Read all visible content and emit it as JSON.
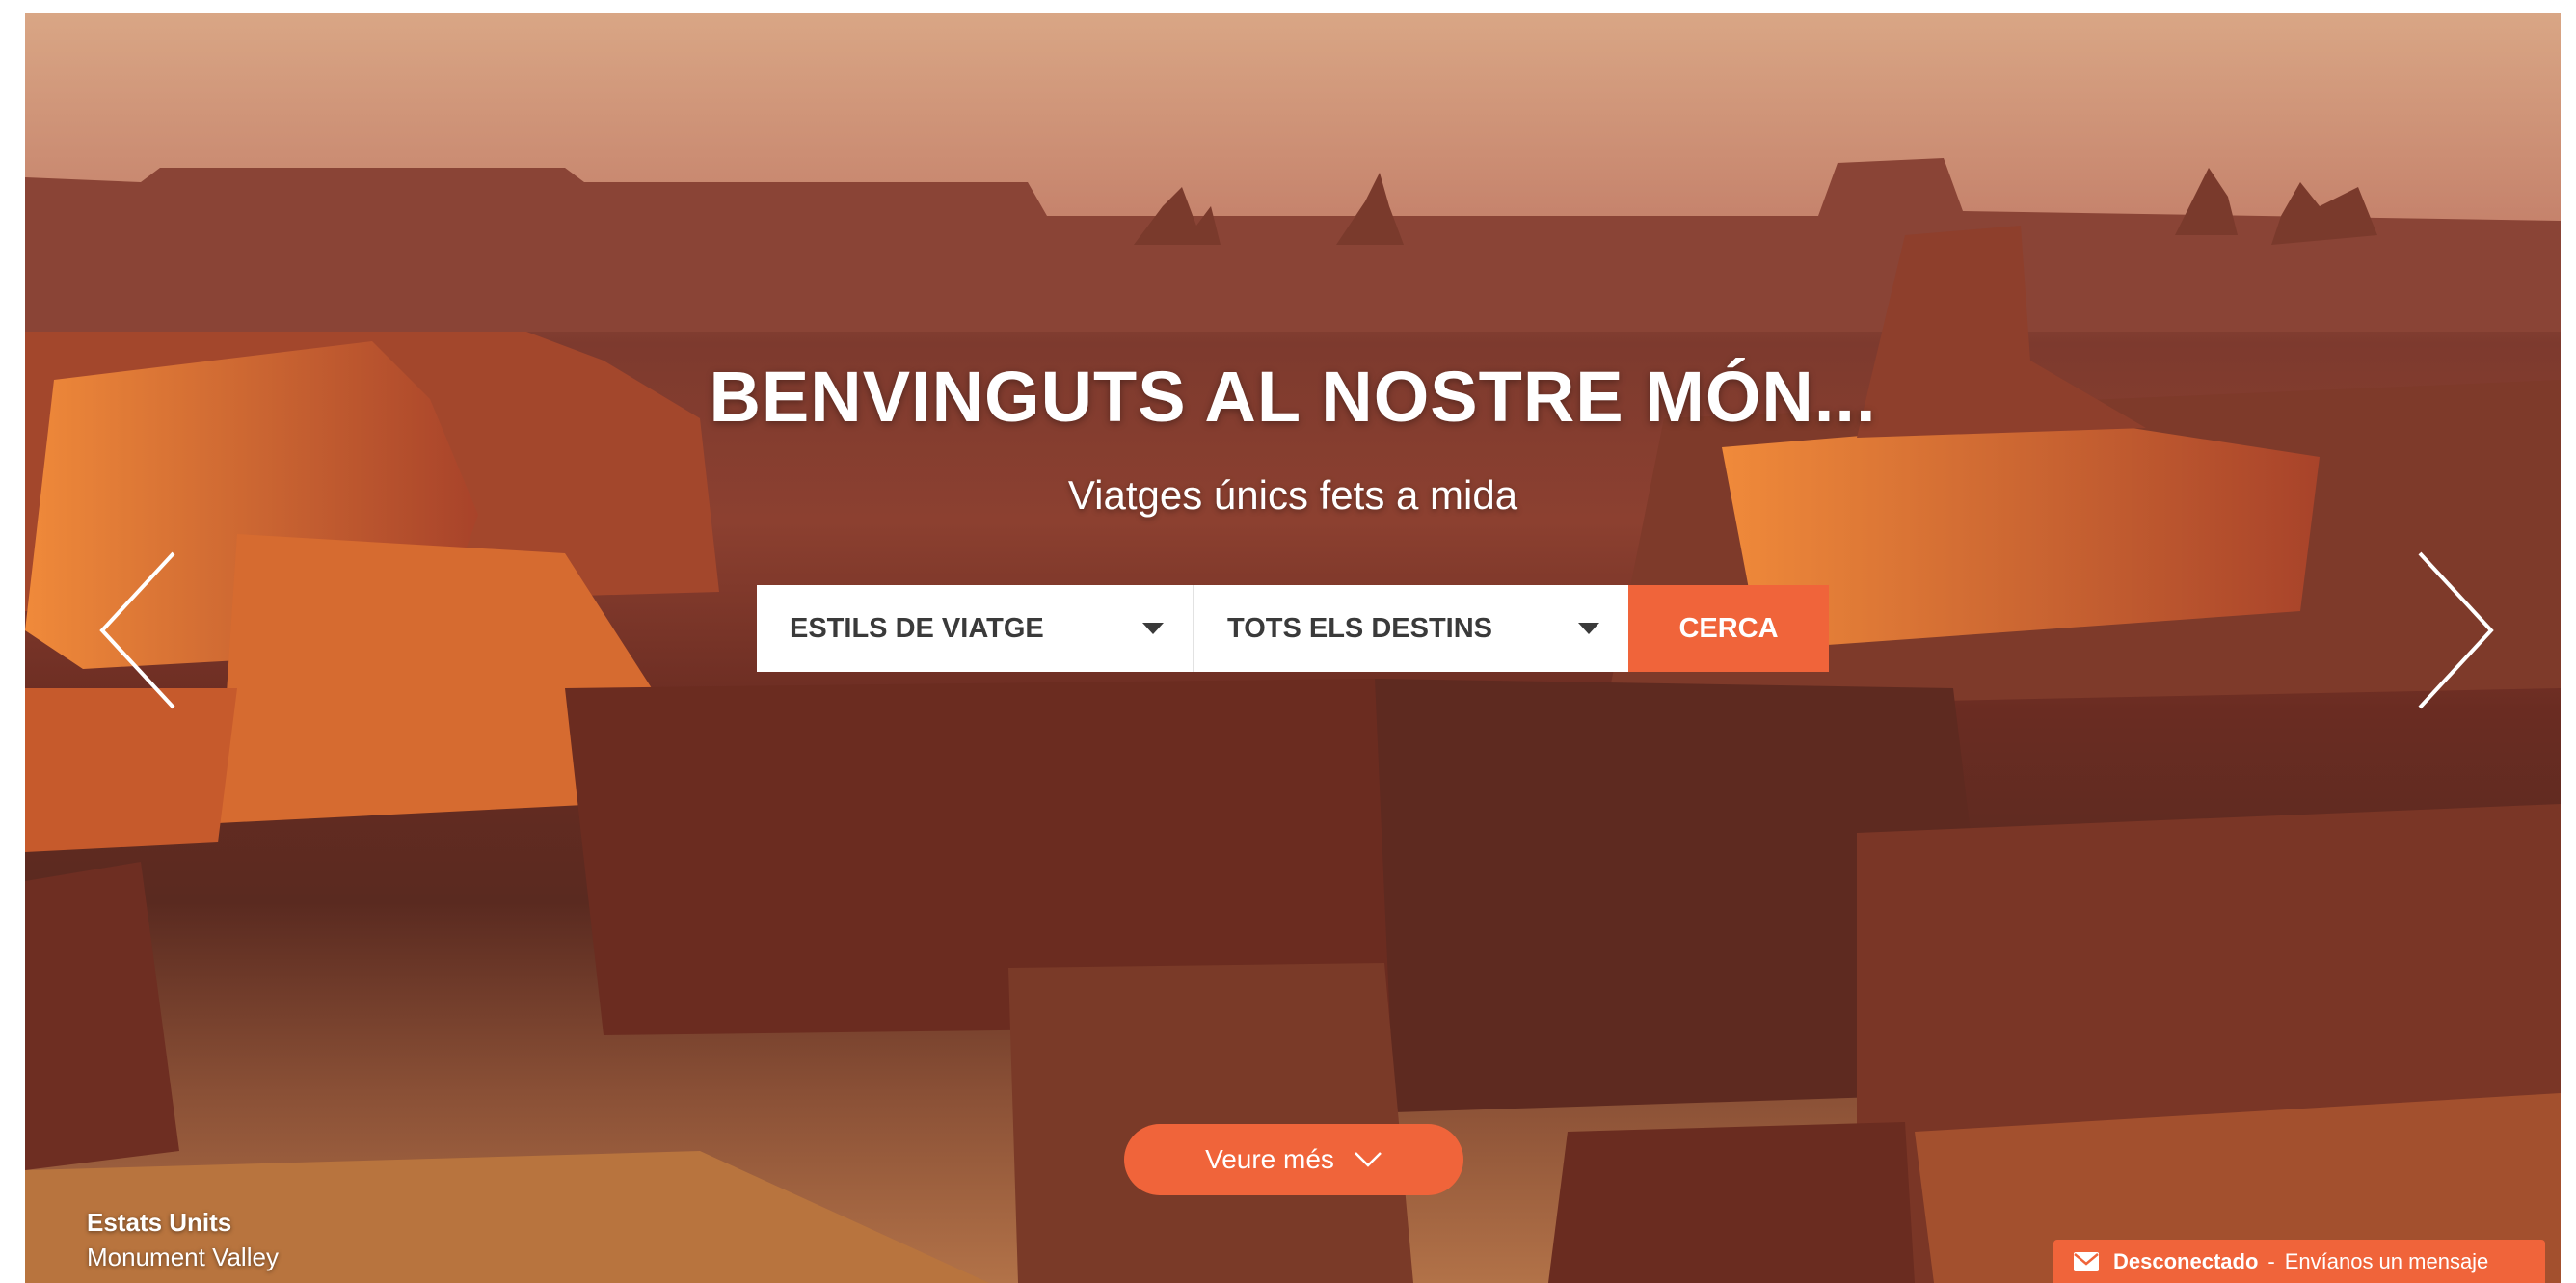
{
  "hero": {
    "title": "BENVINGUTS AL NOSTRE MÓN...",
    "subtitle": "Viatges únics fets a mida"
  },
  "search": {
    "styles_label": "ESTILS DE VIATGE",
    "destinations_label": "TOTS ELS DESTINS",
    "button_label": "CERCA"
  },
  "carousel": {
    "prev_icon": "chevron-left-icon",
    "next_icon": "chevron-right-icon"
  },
  "more_button": {
    "label": "Veure més",
    "icon": "chevron-down-icon"
  },
  "caption": {
    "country": "Estats Units",
    "place": "Monument Valley"
  },
  "chat": {
    "icon": "envelope-icon",
    "status": "Desconectado",
    "separator": "-",
    "message": "Envíanos un mensaje"
  },
  "colors": {
    "accent": "#f0643a",
    "white": "#ffffff"
  }
}
